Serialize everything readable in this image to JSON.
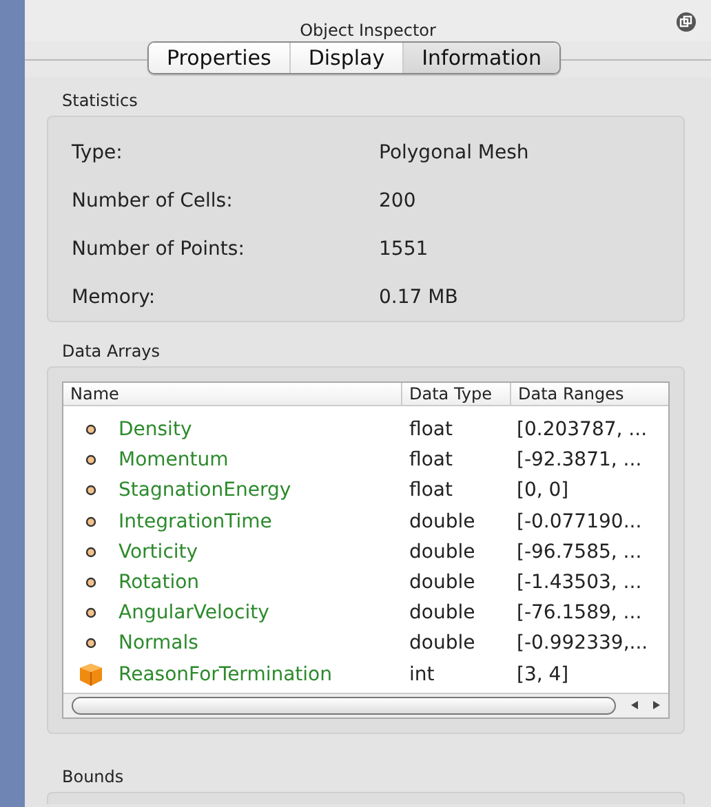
{
  "window": {
    "title": "Object Inspector"
  },
  "tabs": [
    {
      "label": "Properties",
      "selected": false
    },
    {
      "label": "Display",
      "selected": false
    },
    {
      "label": "Information",
      "selected": true
    }
  ],
  "statistics": {
    "title": "Statistics",
    "rows": [
      {
        "label": "Type:",
        "value": "Polygonal Mesh"
      },
      {
        "label": "Number of Cells:",
        "value": "200"
      },
      {
        "label": "Number of Points:",
        "value": "1551"
      },
      {
        "label": "Memory:",
        "value": "0.17 MB"
      }
    ]
  },
  "data_arrays": {
    "title": "Data Arrays",
    "columns": [
      "Name",
      "Data Type",
      "Data Ranges"
    ],
    "rows": [
      {
        "kind": "point",
        "name": "Density",
        "type": "float",
        "range": "[0.203787, ..."
      },
      {
        "kind": "point",
        "name": "Momentum",
        "type": "float",
        "range": "[-92.3871, ..."
      },
      {
        "kind": "point",
        "name": "StagnationEnergy",
        "type": "float",
        "range": "[0, 0]"
      },
      {
        "kind": "point",
        "name": "IntegrationTime",
        "type": "double",
        "range": "[-0.077190..."
      },
      {
        "kind": "point",
        "name": "Vorticity",
        "type": "double",
        "range": "[-96.7585, ..."
      },
      {
        "kind": "point",
        "name": "Rotation",
        "type": "double",
        "range": "[-1.43503, ..."
      },
      {
        "kind": "point",
        "name": "AngularVelocity",
        "type": "double",
        "range": "[-76.1589, ..."
      },
      {
        "kind": "point",
        "name": "Normals",
        "type": "double",
        "range": "[-0.992339,..."
      },
      {
        "kind": "cell",
        "name": "ReasonForTermination",
        "type": "int",
        "range": "[3, 4]"
      }
    ]
  },
  "bounds": {
    "title": "Bounds"
  }
}
